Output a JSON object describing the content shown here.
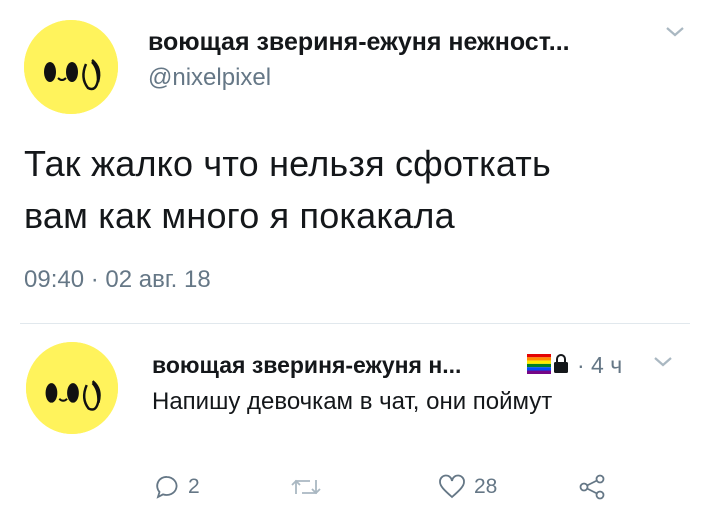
{
  "main_tweet": {
    "display_name": "воющая звериня-ежуня нежност...",
    "handle": "@nixelpixel",
    "text_line_1": "Так жалко что нельзя сфоткать",
    "text_line_2": "вам как много я покакала",
    "timestamp": "09:40 · 02 авг. 18",
    "menu_icon": "chevron-down-icon"
  },
  "reply_tweet": {
    "display_name": "воющая звериня-ежуня н...",
    "flag_emoji": "rainbow-flag-icon",
    "lock_icon": "lock-icon",
    "time": "· 4 ч",
    "text": "Напишу девочкам в чат, они поймут",
    "menu_icon": "chevron-down-icon",
    "actions": {
      "reply_count": "2",
      "retweet_count": "",
      "like_count": "28"
    }
  },
  "colors": {
    "text": "#14171a",
    "secondary": "#657786",
    "divider": "#e1e8ed",
    "icon": "#aab8c2",
    "avatar_bg": "#fff35c"
  }
}
